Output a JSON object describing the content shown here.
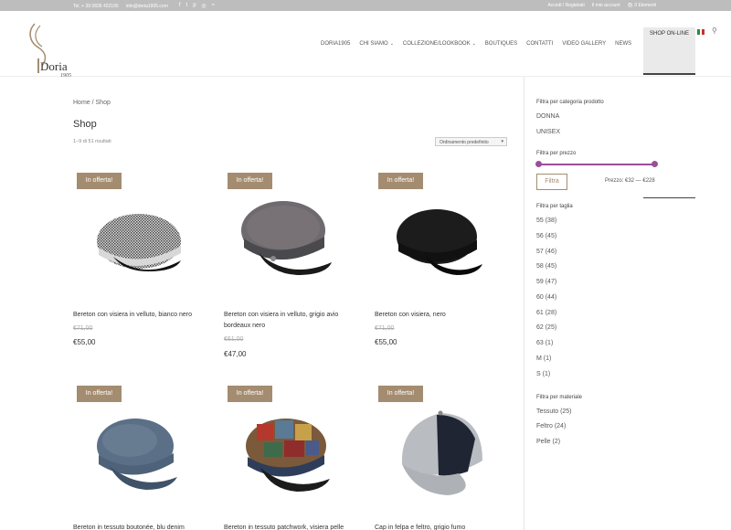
{
  "topbar": {
    "phone": "Tel. + 39 0836 422165",
    "email": "info@doria1905.com",
    "social_icons": [
      "facebook-icon",
      "twitter-icon",
      "pinterest-icon",
      "instagram-icon",
      "rss-icon"
    ],
    "login": "Accedi / Registrati",
    "my_account": "Il mio account",
    "cart": "0 Elementi"
  },
  "brand": {
    "name": "Doria",
    "year": "1905",
    "color": "#a48c70"
  },
  "nav": {
    "items": [
      {
        "label": "DORIA1905",
        "caret": false
      },
      {
        "label": "CHI SIAMO",
        "caret": true
      },
      {
        "label": "COLLEZIONE/LOOKBOOK",
        "caret": true
      },
      {
        "label": "BOUTIQUES",
        "caret": false
      },
      {
        "label": "CONTATTI",
        "caret": false
      },
      {
        "label": "VIDEO GALLERY",
        "caret": false
      },
      {
        "label": "NEWS",
        "caret": false
      }
    ],
    "active": "SHOP ON-LINE"
  },
  "breadcrumb": "Home / Shop",
  "page_title": "Shop",
  "result_count": "1–9 di 51 risultati",
  "orderby": "Ordinamento predefinito",
  "badge_label": "In offerta!",
  "products": [
    {
      "name": "Bereton con visiera in velluto, bianco nero",
      "old": "€71,00",
      "new": "€55,00"
    },
    {
      "name": "Bereton con visiera in velluto, grigio avio bordeaux nero",
      "old": "€61,00",
      "new": "€47,00"
    },
    {
      "name": "Bereton con visiera, nero",
      "old": "€71,00",
      "new": "€55,00"
    },
    {
      "name": "Bereton in tessuto boutonée, blu denim",
      "old": "",
      "new": ""
    },
    {
      "name": "Bereton in tessuto patchwork, visiera pelle",
      "old": "",
      "new": ""
    },
    {
      "name": "Cap in felpa e feltro, grigio fumo",
      "old": "",
      "new": ""
    }
  ],
  "sidebar": {
    "category_title": "Filtra per categoria prodotto",
    "categories": [
      "DONNA",
      "UNISEX"
    ],
    "price_title": "Filtra per prezzo",
    "price_min": 32,
    "price_max": 228,
    "filter_button": "Filtra",
    "price_range": "Prezzo: €32 — €228",
    "size_title": "Filtra per taglia",
    "sizes": [
      "55 (38)",
      "56 (45)",
      "57 (46)",
      "58 (45)",
      "59 (47)",
      "60 (44)",
      "61 (28)",
      "62 (25)",
      "63 (1)",
      "M (1)",
      "S (1)"
    ],
    "material_title": "Filtra per materiale",
    "materials": [
      "Tessuto (25)",
      "Feltro (24)",
      "Pelle (2)"
    ]
  },
  "colors": {
    "accent": "#a48c70",
    "slider": "#9b4f96"
  }
}
